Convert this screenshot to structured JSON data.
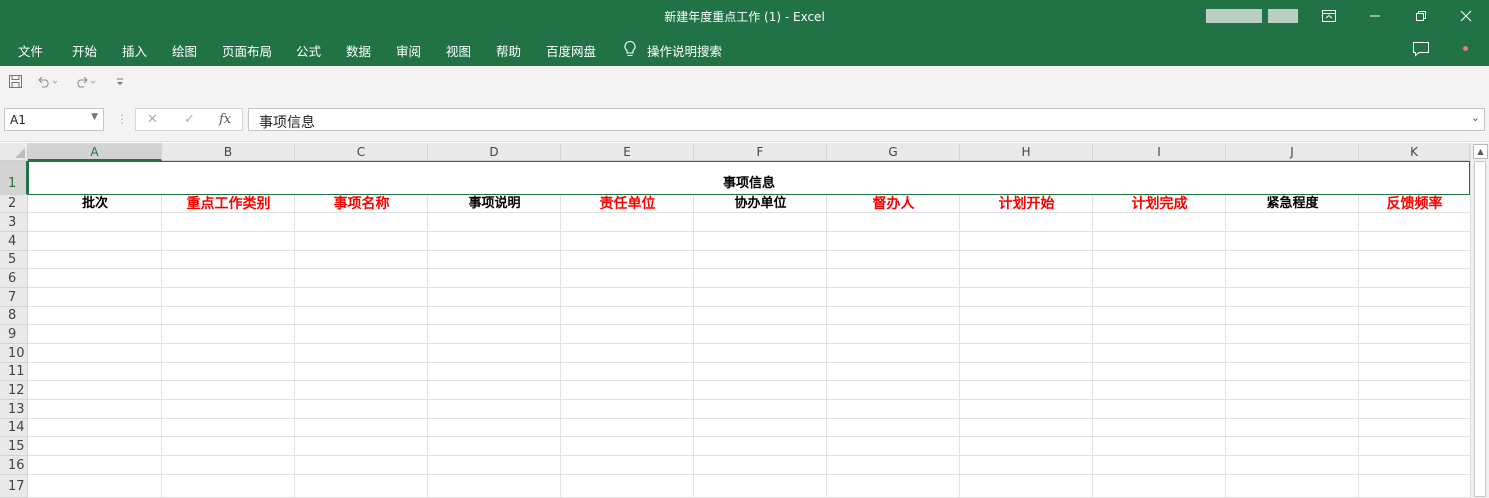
{
  "window": {
    "title": "新建年度重点工作 (1)  -  Excel",
    "ribbon_display_icon": "ribbon-display-options-icon",
    "minimize_icon": "minimize-icon",
    "restore_icon": "restore-icon",
    "close_icon": "close-icon"
  },
  "ribbon": {
    "tabs": [
      "文件",
      "开始",
      "插入",
      "绘图",
      "页面布局",
      "公式",
      "数据",
      "审阅",
      "视图",
      "帮助",
      "百度网盘"
    ],
    "tell_me": "操作说明搜索",
    "comment_icon": "comment-icon"
  },
  "qat": {
    "save_icon": "save-icon",
    "undo_icon": "undo-icon",
    "redo_icon": "redo-icon",
    "customize_icon": "customize-qat-icon"
  },
  "formula_bar": {
    "name_box": "A1",
    "formula": "事项信息",
    "fx": "fx"
  },
  "sheet": {
    "columns": [
      "A",
      "B",
      "C",
      "D",
      "E",
      "F",
      "G",
      "H",
      "I",
      "J",
      "K"
    ],
    "rows": [
      "1",
      "2",
      "3",
      "4",
      "5",
      "6",
      "7",
      "8",
      "9",
      "10",
      "11",
      "12",
      "13",
      "14",
      "15",
      "16",
      "17"
    ],
    "merged_title": "事项信息",
    "header_row": [
      {
        "text": "批次",
        "color": "#000000"
      },
      {
        "text": "重点工作类别",
        "color": "#ff0000"
      },
      {
        "text": "事项名称",
        "color": "#ff0000"
      },
      {
        "text": "事项说明",
        "color": "#000000"
      },
      {
        "text": "责任单位",
        "color": "#ff0000"
      },
      {
        "text": "协办单位",
        "color": "#000000"
      },
      {
        "text": "督办人",
        "color": "#ff0000"
      },
      {
        "text": "计划开始",
        "color": "#ff0000"
      },
      {
        "text": "计划完成",
        "color": "#ff0000"
      },
      {
        "text": "紧急程度",
        "color": "#000000"
      },
      {
        "text": "反馈频率",
        "color": "#ff0000"
      }
    ]
  },
  "colors": {
    "accent": "#217346",
    "required_header": "#ff0000"
  }
}
